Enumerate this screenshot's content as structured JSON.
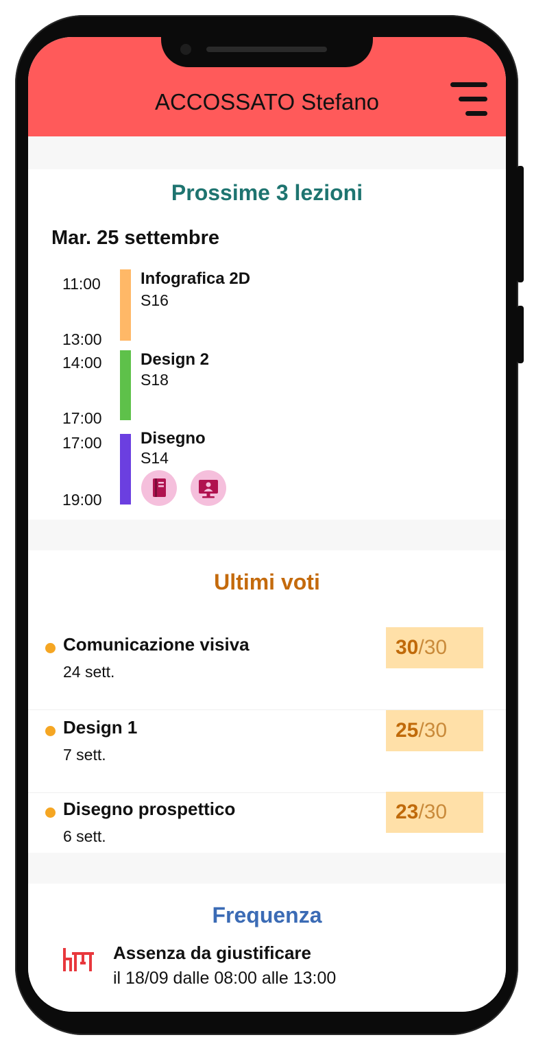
{
  "header": {
    "title": "ACCOSSATO Stefano"
  },
  "lessons_card": {
    "title": "Prossime 3 lezioni",
    "day": "Mar. 25 settembre",
    "lessons": [
      {
        "start": "11:00",
        "end": "13:00",
        "name": "Infografica 2D",
        "room": "S16",
        "color": "#ffb867"
      },
      {
        "start": "14:00",
        "end": "17:00",
        "name": "Design 2",
        "room": "S18",
        "color": "#5ec14a"
      },
      {
        "start": "17:00",
        "end": "19:00",
        "name": "Disegno",
        "room": "S14",
        "color": "#6b3fe0",
        "icons": [
          "book-icon",
          "online-class-icon"
        ]
      }
    ]
  },
  "grades_card": {
    "title": "Ultimi voti",
    "items": [
      {
        "subject": "Comunicazione visiva",
        "date": "24 sett.",
        "grade": "30",
        "max": "/30"
      },
      {
        "subject": "Design 1",
        "date": "7 sett.",
        "grade": "25",
        "max": "/30"
      },
      {
        "subject": "Disegno prospettico",
        "date": "6 sett.",
        "grade": "23",
        "max": "/30"
      }
    ]
  },
  "attendance_card": {
    "title": "Frequenza",
    "absence_title": "Assenza da giustificare",
    "absence_detail": "il 18/09 dalle 08:00 alle 13:00",
    "icon": "classroom-absence-icon"
  },
  "colors": {
    "header_bg": "#ff5a5a",
    "lessons_title": "#1e7470",
    "grades_title": "#c46a0c",
    "attendance_title": "#3b6bb5",
    "absence_icon": "#e8383d",
    "grade_bg": "#ffe0a8"
  }
}
